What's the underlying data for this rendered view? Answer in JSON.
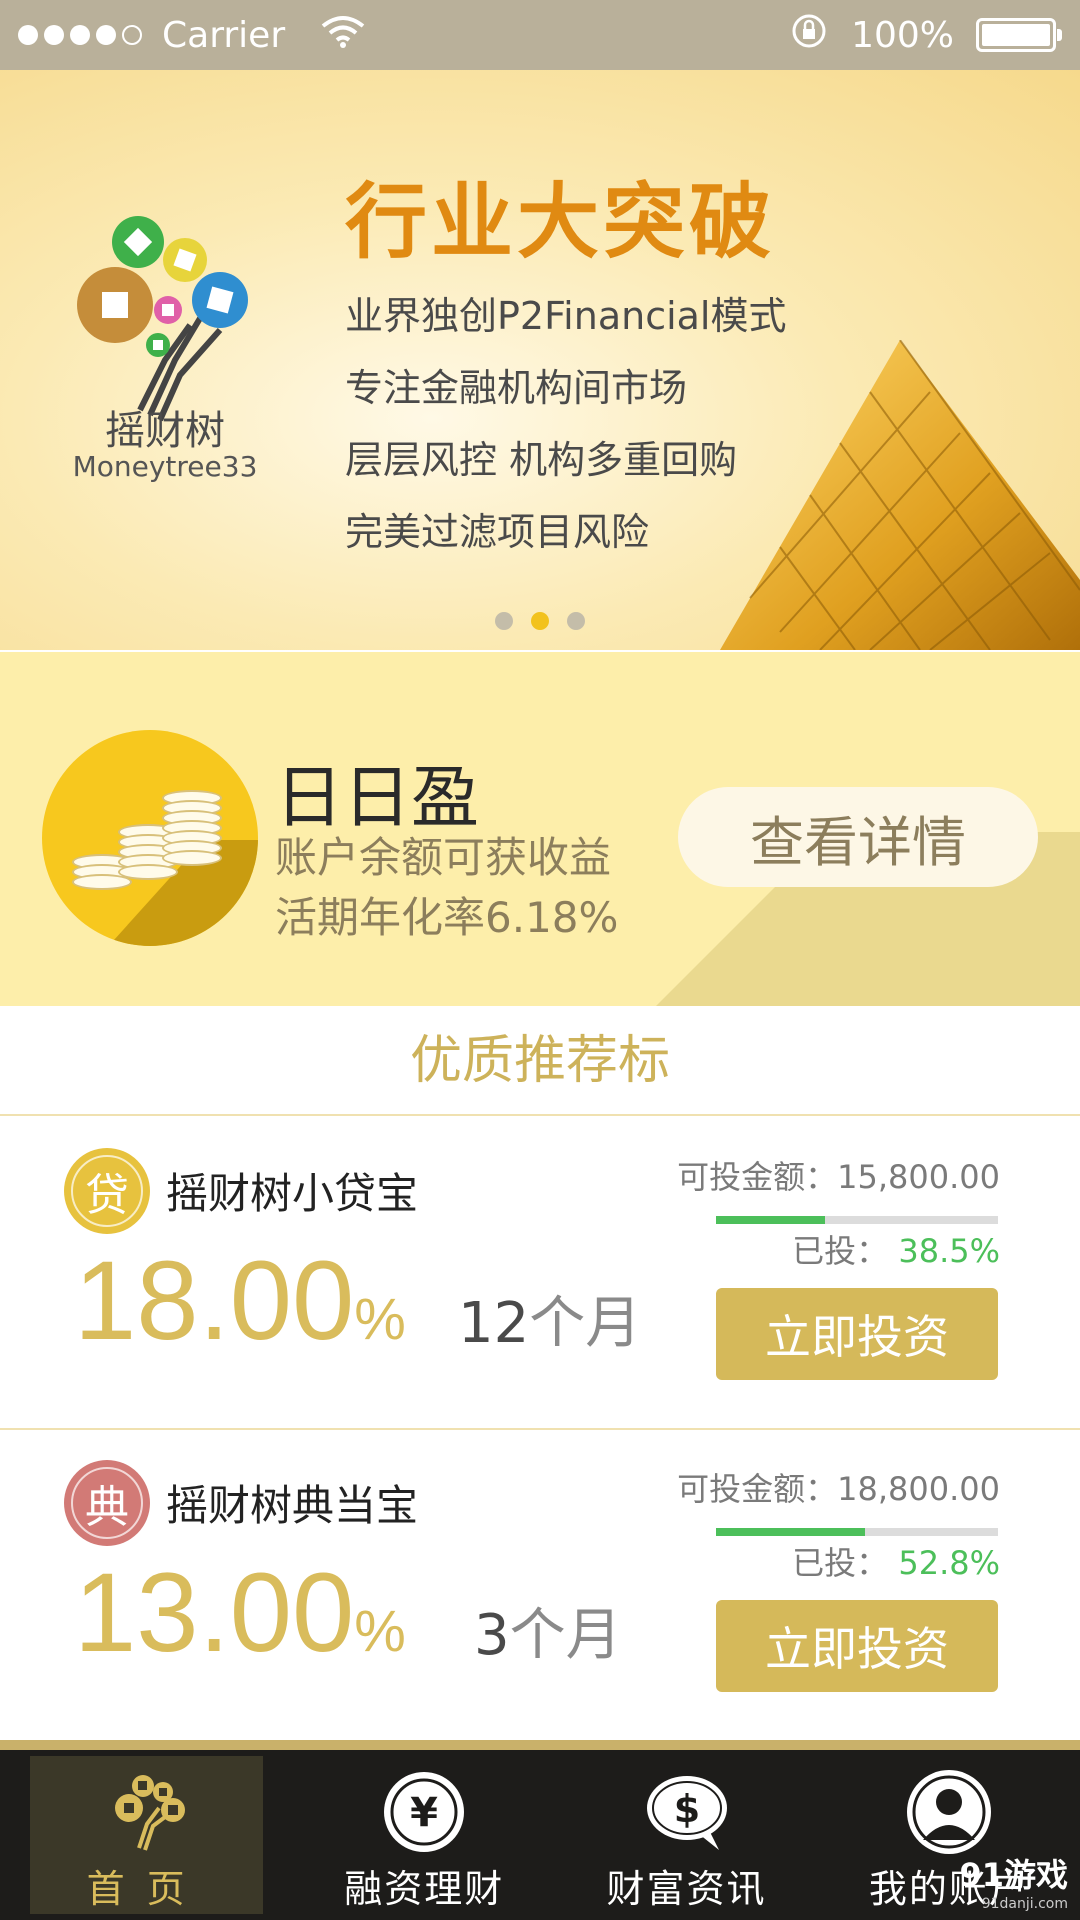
{
  "status_bar": {
    "carrier": "Carrier",
    "battery_text": "100%",
    "signal_icon": "signal-dots-icon",
    "wifi_icon": "wifi-icon",
    "rotation_lock_icon": "rotation-lock-icon"
  },
  "banner": {
    "logo_cn": "摇财树",
    "logo_en": "Moneytree33",
    "headline": "行业大突破",
    "lines": [
      "业界独创P2Financial模式",
      "专注金融机构间市场",
      "层层风控 机构多重回购",
      "完美过滤项目风险"
    ],
    "page_count": 3,
    "active_page": 2
  },
  "promo": {
    "title": "日日盈",
    "subtitle": "账户余额可获收益",
    "rate_line": "活期年化率6.18%",
    "button_label": "查看详情"
  },
  "section": {
    "title": "优质推荐标"
  },
  "products": [
    {
      "badge": "贷",
      "badge_color": "#e7c23e",
      "name": "摇财树小贷宝",
      "rate": "18.00",
      "rate_unit": "%",
      "term_num": "12",
      "term_unit": "个月",
      "available": "可投金额：15,800.00",
      "invested_label": "已投：",
      "invested_value": "38.5%",
      "progress": 0.385,
      "button_label": "立即投资"
    },
    {
      "badge": "典",
      "badge_color": "#d27a76",
      "name": "摇财树典当宝",
      "rate": "13.00",
      "rate_unit": "%",
      "term_num": "3",
      "term_unit": "个月",
      "available": "可投金额：18,800.00",
      "invested_label": "已投：",
      "invested_value": "52.8%",
      "progress": 0.528,
      "button_label": "立即投资"
    }
  ],
  "tabs": [
    {
      "label": "首页",
      "icon": "money-tree-icon",
      "active": true
    },
    {
      "label": "融资理财",
      "icon": "yen-icon",
      "active": false
    },
    {
      "label": "财富资讯",
      "icon": "dollar-bubble-icon",
      "active": false
    },
    {
      "label": "我的账户",
      "icon": "user-icon",
      "active": false
    }
  ],
  "watermark": {
    "main": "91游戏",
    "sub": "91danji.com"
  },
  "colors": {
    "accent_gold": "#d5b95a",
    "progress_green": "#4cbf5a",
    "banner_orange": "#e08a12",
    "tabbar_bg": "#1d1c1a"
  }
}
